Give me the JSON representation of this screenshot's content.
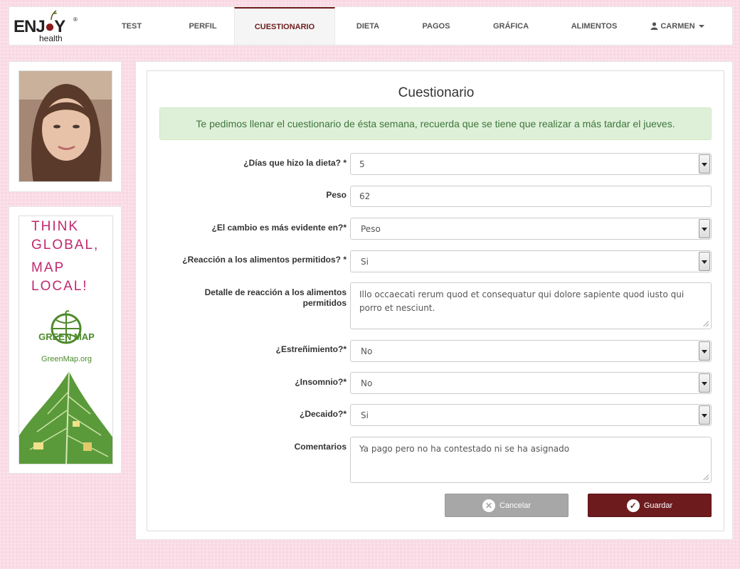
{
  "brand": {
    "word_a": "ENJ",
    "word_b": "Y",
    "mark": "®",
    "sub": "health"
  },
  "nav": {
    "items": [
      "TEST",
      "PERFIL",
      "CUESTIONARIO",
      "DIETA",
      "PAGOS",
      "GRÁFICA",
      "ALIMENTOS"
    ],
    "active": "CUESTIONARIO",
    "user": "CARMEN"
  },
  "ad": {
    "lines": [
      "THINK",
      "GLOBAL,",
      "MAP",
      "LOCAL!"
    ],
    "brand": "GREEN MAP",
    "url": "GreenMap.org"
  },
  "form": {
    "title": "Cuestionario",
    "alert": "Te pedimos llenar el cuestionario de ésta semana, recuerda que se tiene que realizar a más tardar el jueves.",
    "fields": [
      {
        "label": "¿Días que hizo la dieta? *",
        "value": "5"
      },
      {
        "label": "Peso",
        "value": "62"
      },
      {
        "label": "¿El cambio es más evidente en?*",
        "value": "Peso"
      },
      {
        "label": "¿Reacción a los alimentos permitidos? *",
        "value": "Si"
      },
      {
        "label_line1": "Detalle de reacción a los alimentos",
        "label_line2": "permitidos",
        "value": "Illo occaecati rerum quod et consequatur qui dolore sapiente quod iusto qui porro et nesciunt."
      },
      {
        "label": "¿Estreñimiento?*",
        "value": "No"
      },
      {
        "label": "¿Insomnio?*",
        "value": "No"
      },
      {
        "label": "¿Decaido?*",
        "value": "Si"
      },
      {
        "label": "Comentarios",
        "value": "Ya pago pero no ha contestado ni se ha asignado"
      }
    ],
    "cancel_label": "Cancelar",
    "save_label": "Guardar"
  },
  "colors": {
    "accent": "#6e1b1e",
    "alert_bg": "#dff0d8",
    "alert_text": "#3c763d",
    "page_bg": "#f9d7e2"
  }
}
